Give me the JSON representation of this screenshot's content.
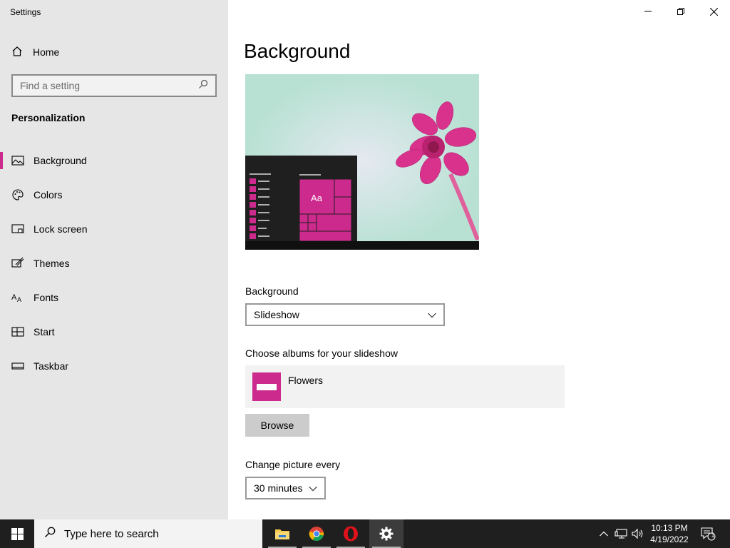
{
  "window": {
    "title": "Settings",
    "controls": {
      "minimize": "minimize",
      "restore": "restore",
      "close": "close"
    }
  },
  "sidebar": {
    "home_label": "Home",
    "search_placeholder": "Find a setting",
    "section_title": "Personalization",
    "items": [
      {
        "label": "Background",
        "icon": "picture-icon",
        "active": true
      },
      {
        "label": "Colors",
        "icon": "palette-icon"
      },
      {
        "label": "Lock screen",
        "icon": "lock-screen-icon"
      },
      {
        "label": "Themes",
        "icon": "themes-icon"
      },
      {
        "label": "Fonts",
        "icon": "fonts-icon"
      },
      {
        "label": "Start",
        "icon": "start-icon"
      },
      {
        "label": "Taskbar",
        "icon": "taskbar-icon"
      }
    ]
  },
  "main": {
    "page_title": "Background",
    "preview": {
      "tile_text": "Aa",
      "accent_color": "#cc2a8d"
    },
    "background_label": "Background",
    "background_value": "Slideshow",
    "albums_label": "Choose albums for your slideshow",
    "album_name": "Flowers",
    "browse_label": "Browse",
    "change_label": "Change picture every",
    "change_value": "30 minutes"
  },
  "taskbar": {
    "search_placeholder": "Type here to search",
    "apps": [
      "file-explorer-icon",
      "chrome-icon",
      "opera-icon",
      "settings-icon"
    ],
    "time": "10:13 PM",
    "date": "4/19/2022",
    "notification_count": "1"
  },
  "colors": {
    "accent": "#cc2a8d",
    "sidebar_bg": "#e6e6e6",
    "taskbar_bg": "#1f1f1f"
  }
}
